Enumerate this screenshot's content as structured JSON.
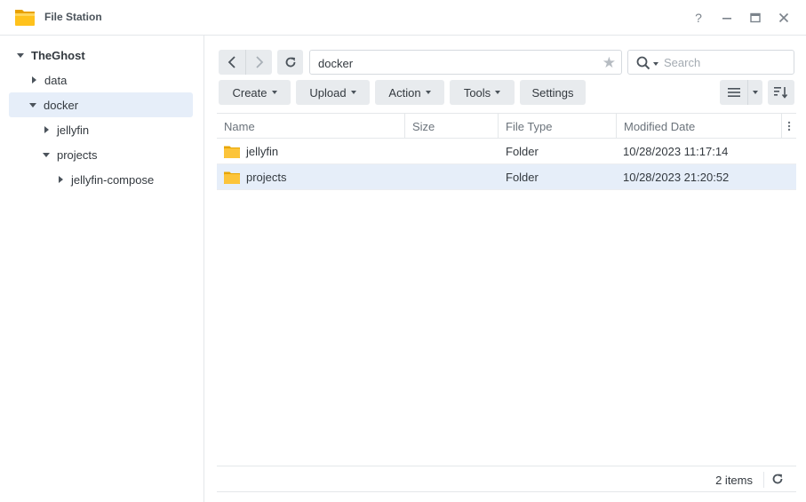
{
  "window": {
    "title": "File Station",
    "help_symbol": "?"
  },
  "sidebar": {
    "items": [
      {
        "label": "TheGhost"
      },
      {
        "label": "data"
      },
      {
        "label": "docker"
      },
      {
        "label": "jellyfin"
      },
      {
        "label": "projects"
      },
      {
        "label": "jellyfin-compose"
      }
    ]
  },
  "toolbar": {
    "path": "docker",
    "search_placeholder": "Search",
    "create_label": "Create",
    "upload_label": "Upload",
    "action_label": "Action",
    "tools_label": "Tools",
    "settings_label": "Settings"
  },
  "table": {
    "columns": [
      "Name",
      "Size",
      "File Type",
      "Modified Date"
    ],
    "rows": [
      {
        "name": "jellyfin",
        "size": "",
        "type": "Folder",
        "modified": "10/28/2023 11:17:14"
      },
      {
        "name": "projects",
        "size": "",
        "type": "Folder",
        "modified": "10/28/2023 21:20:52"
      }
    ]
  },
  "footer": {
    "count": "2 items"
  },
  "colors": {
    "accent_selected": "#e6eef9",
    "folder": "#f8c33c"
  }
}
